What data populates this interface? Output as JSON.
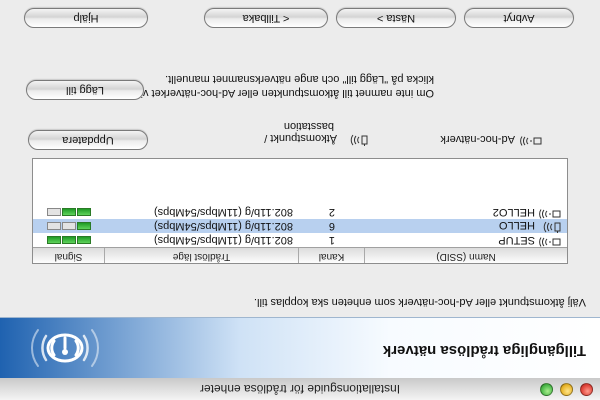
{
  "window": {
    "title": "Installationsguide för trådlösa enheter"
  },
  "header": {
    "title": "Tillgängliga trådlösa nätverk"
  },
  "instruction": "Välj åtkomstpunkt eller Ad-hoc-nätverk som enheten ska kopplas till.",
  "table": {
    "columns": [
      "Namn (SSID)",
      "Kanal",
      "Trådlöst läge",
      "Signal"
    ],
    "rows": [
      {
        "ssid": "SETUP",
        "type": "adhoc",
        "channel": "1",
        "mode": "802.11b/g (11Mbps/54Mbps)",
        "signal_bars": 3,
        "selected": false
      },
      {
        "ssid": "HELLO",
        "type": "accesspoint",
        "channel": "6",
        "mode": "802.11b/g (11Mbps/54Mbps)",
        "signal_bars": 1,
        "selected": true
      },
      {
        "ssid": "HELLO2",
        "type": "adhoc",
        "channel": "2",
        "mode": "802.11b/g (11Mbps/54Mbps)",
        "signal_bars": 2,
        "selected": false
      }
    ]
  },
  "legend": {
    "adhoc": "Ad-hoc-nätverk",
    "accesspoint_line1": "Åtkomstpunkt /",
    "accesspoint_line2": "basstation"
  },
  "buttons": {
    "refresh": "Uppdatera",
    "add": "Lägg till",
    "help": "Hjälp",
    "back": "< Tillbaka",
    "next": "Nästa >",
    "cancel": "Avbryt"
  },
  "note": {
    "line1": "Om inte namnet till åtkomstpunkten eller Ad-hoc-nätverket visas, ska du",
    "line2": "klicka på \"Lägg till\" och ange nätverksnamnet manuellt."
  },
  "colors": {
    "selection": "#b8d0ef",
    "signal_on": "#2fb33a",
    "header_blue": "#1f62b0"
  }
}
